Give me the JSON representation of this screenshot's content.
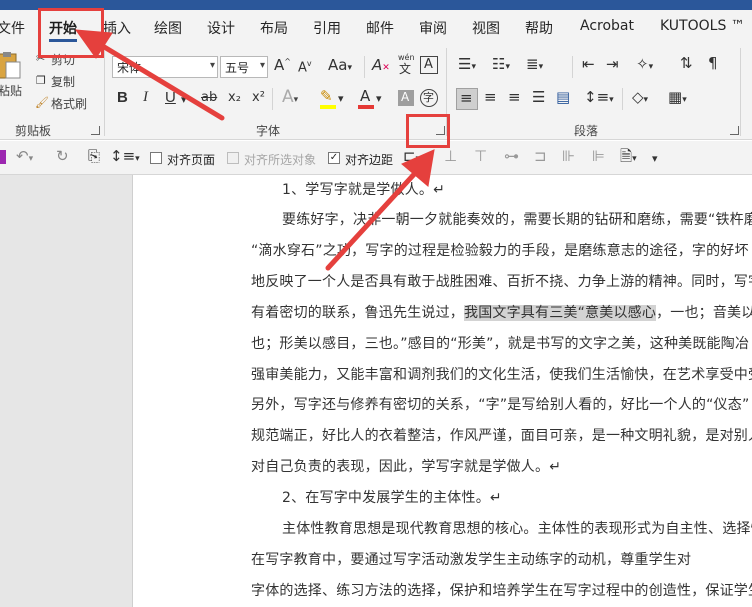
{
  "tabs": [
    "文件",
    "开始",
    "插入",
    "绘图",
    "设计",
    "布局",
    "引用",
    "邮件",
    "审阅",
    "视图",
    "帮助",
    "Acrobat",
    "KUTOOLS ™"
  ],
  "clipboard": {
    "paste": "粘贴",
    "cut": "剪切",
    "copy": "复制",
    "format_painter": "格式刷",
    "group_label": "剪贴板"
  },
  "font": {
    "name": "宋体",
    "size": "五号",
    "group_label": "字体",
    "grow": "A",
    "shrink": "A",
    "case": "Aa",
    "clear": "A",
    "phonetic_top": "wén",
    "phonetic": "文",
    "border": "A",
    "bold": "B",
    "italic": "I",
    "underline": "U",
    "strike": "ab",
    "sub": "x₂",
    "sup": "x²",
    "effects": "A",
    "color": "A",
    "shade": "A",
    "enclose": "字"
  },
  "paragraph": {
    "group_label": "段落"
  },
  "toolbar2": {
    "align_page": "对齐页面",
    "align_selected": "对齐所选对象",
    "align_margin": "对齐边距"
  },
  "document": {
    "lines": [
      "1、学写字就是学做人。↵",
      "要练好字，决非一朝一夕就能奏效的，需要长期的钻研和磨练，需要“铁杵磨",
      "“滴水穿石”之功，写字的过程是检验毅力的手段，是磨练意志的途径，字的好坏",
      "地反映了一个人是否具有敢于战胜困难、百折不挠、力争上游的精神。同时，写字",
      "有着密切的联系，鲁迅先生说过，",
      "我国文字具有三美“意美以感心",
      "，一也；音美以",
      "也；形美以感目，三也。”感目的“形美”，就是书写的文字之美，这种美既能陶冶",
      "强审美能力，又能丰富和调剂我们的文化生活，使我们生活愉快，在艺术享受中受",
      "另外，写字还与修养有密切的关系，“字”是写给别人看的，好比一个人的“仪态”",
      "规范端正，好比人的衣着整洁，作风严谨，面目可亲，是一种文明礼貌，是对别人",
      "对自己负责的表现，因此，学写字就是学做人。↵",
      "2、在写字中发展学生的主体性。↵",
      "主体性教育思想是现代教育思想的核心。主体性的表现形式为自主性、选择性、",
      "在写字教育中，要通过写字活动激发学生主动练字的动机，尊重学生对",
      "字体的选择、练习方法的选择，保护和培养学生在写字过程中的创造性，保证学生"
    ]
  },
  "colors": {
    "accent": "#2b579a",
    "annotation": "#e5403d",
    "highlight": "#d3d3d3",
    "font_color_bar": "#e53935",
    "highlight_bar": "#ffff00"
  }
}
